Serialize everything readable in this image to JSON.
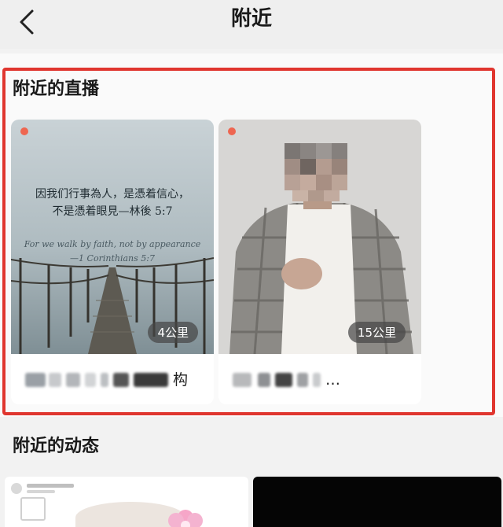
{
  "header": {
    "title": "附近",
    "back_icon": "chevron-left-icon"
  },
  "live": {
    "title": "附近的直播",
    "cards": [
      {
        "distance": "4公里",
        "poster_lines": [
          "因我们行事為人，是憑着信心，",
          "不是憑着眼見—林後 5:7",
          "For we walk by faith, not by appearance",
          "—1 Corinthians 5:7"
        ],
        "name_trailing": "构"
      },
      {
        "distance": "15公里",
        "name_trailing": "…"
      }
    ]
  },
  "moments": {
    "title": "附近的动态"
  },
  "colors": {
    "highlight": "#e0362f",
    "live_dot": "#ee6650"
  }
}
